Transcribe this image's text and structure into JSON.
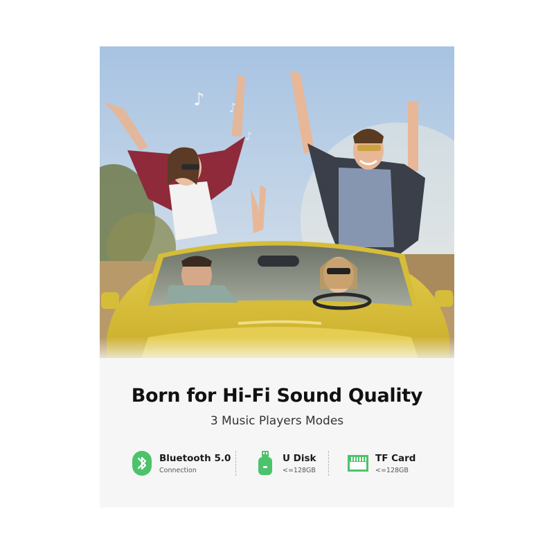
{
  "headline": "Born for Hi-Fi Sound Quality",
  "subheadline": "3 Music Players Modes",
  "features": [
    {
      "title": "Bluetooth 5.0",
      "subtitle": "Connection",
      "icon": "bluetooth-icon"
    },
    {
      "title": "U Disk",
      "subtitle": "<=128GB",
      "icon": "usb-drive-icon"
    },
    {
      "title": "TF Card",
      "subtitle": "<=128GB",
      "icon": "sd-card-icon"
    }
  ],
  "colors": {
    "accent": "#4cc36b",
    "card_background": "#f6f6f6",
    "headline": "#111111",
    "car": "#d9c23a",
    "sky": "#a9c6e4"
  }
}
